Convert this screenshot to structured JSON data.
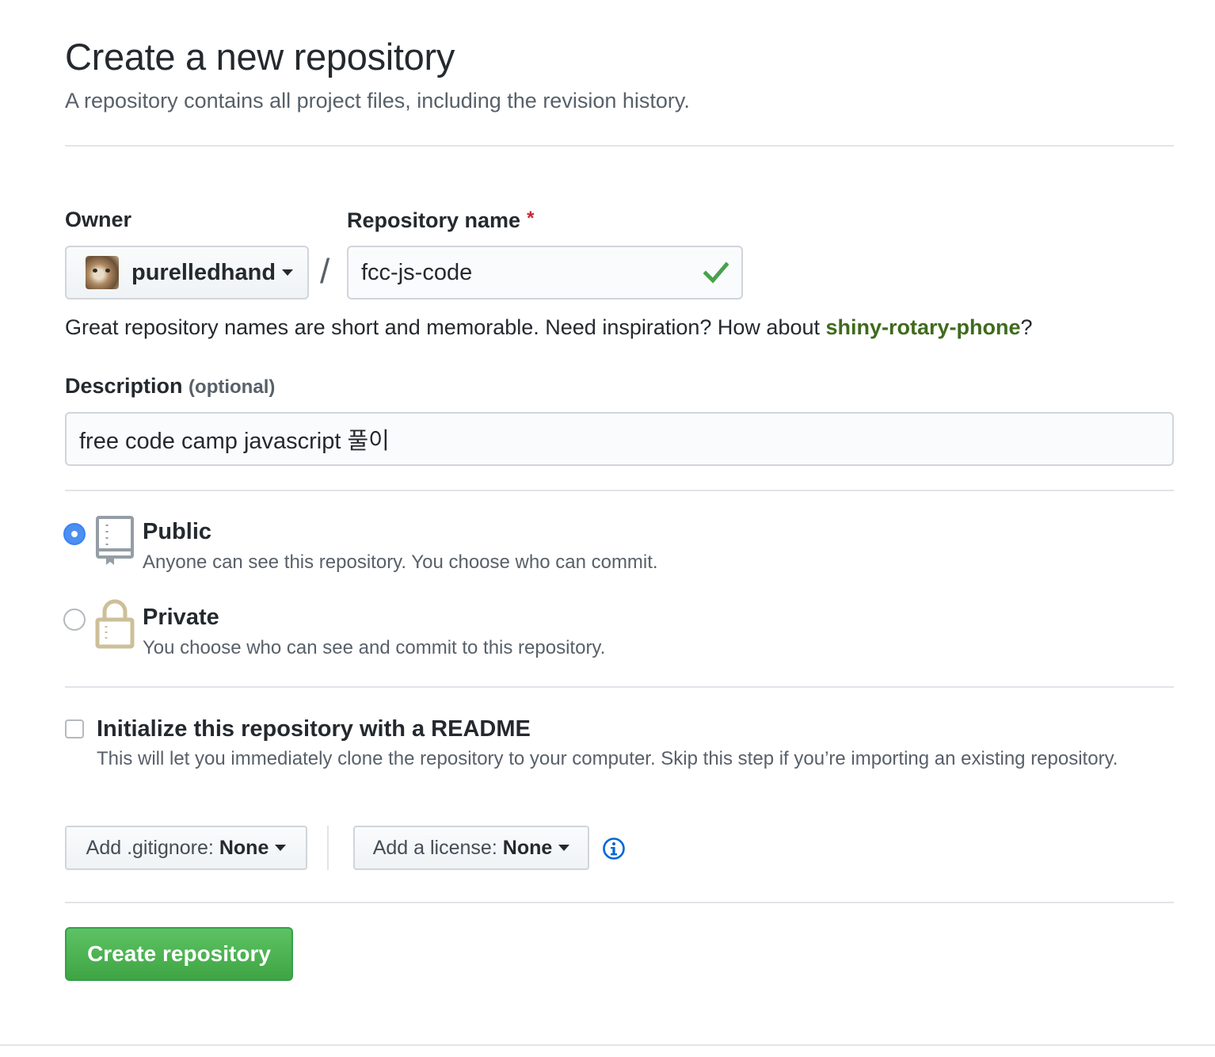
{
  "header": {
    "title": "Create a new repository",
    "subtitle": "A repository contains all project files, including the revision history."
  },
  "owner": {
    "label": "Owner",
    "name": "purelledhand"
  },
  "repo": {
    "label": "Repository name",
    "required_mark": "*",
    "separator": "/",
    "value": "fcc-js-code",
    "hint_prefix": "Great repository names are short and memorable. Need inspiration? How about ",
    "suggestion": "shiny-rotary-phone",
    "hint_suffix": "?"
  },
  "description": {
    "label": "Description",
    "optional": "(optional)",
    "value": "free code camp javascript 풀이"
  },
  "visibility": {
    "public": {
      "title": "Public",
      "desc": "Anyone can see this repository. You choose who can commit.",
      "selected": true
    },
    "private": {
      "title": "Private",
      "desc": "You choose who can see and commit to this repository.",
      "selected": false
    }
  },
  "readme": {
    "title": "Initialize this repository with a README",
    "desc": "This will let you immediately clone the repository to your computer. Skip this step if you’re importing an existing repository.",
    "checked": false
  },
  "gitignore": {
    "prefix": "Add .gitignore:",
    "value": "None"
  },
  "license": {
    "prefix": "Add a license:",
    "value": "None"
  },
  "submit": {
    "label": "Create repository"
  },
  "colors": {
    "accent_green": "#3fa544",
    "suggestion_green": "#3f6b1d",
    "radio_blue": "#4c8ff0",
    "required_red": "#cb2431",
    "info_blue": "#0366d6"
  },
  "icons": [
    "chevron-down-icon",
    "checkmark-icon",
    "repo-book-icon",
    "lock-icon",
    "info-icon"
  ]
}
